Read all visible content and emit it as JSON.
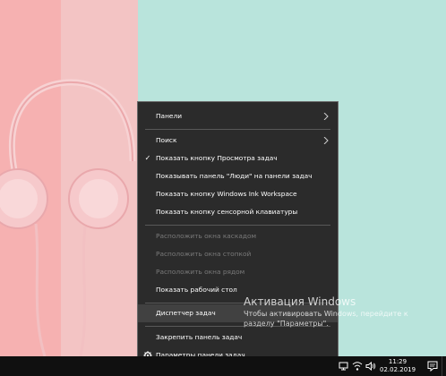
{
  "context_menu": {
    "items": [
      {
        "label": "Панели",
        "submenu": true
      },
      {
        "label": "Поиск",
        "submenu": true
      },
      {
        "label": "Показать кнопку Просмотра задач",
        "checked": true
      },
      {
        "label": "Показывать панель \"Люди\" на панели задач"
      },
      {
        "label": "Показать кнопку Windows Ink Workspace"
      },
      {
        "label": "Показать кнопку сенсорной клавиатуры"
      },
      {
        "label": "Расположить окна каскадом",
        "disabled": true
      },
      {
        "label": "Расположить окна стопкой",
        "disabled": true
      },
      {
        "label": "Расположить окна рядом",
        "disabled": true
      },
      {
        "label": "Показать рабочий стол"
      },
      {
        "label": "Диспетчер задач",
        "highlighted": true
      },
      {
        "label": "Закрепить панель задач"
      },
      {
        "label": "Параметры панели задач",
        "icon": "gear-icon"
      }
    ],
    "check_glyph": "✓"
  },
  "activation": {
    "title": "Активация Windows",
    "line1": "Чтобы активировать Windows, перейдите к",
    "line2": "разделу \"Параметры\"."
  },
  "taskbar": {
    "time": "11:29",
    "date": "02.02.2019",
    "tray_icons": [
      "network-icon",
      "wifi-icon",
      "volume-icon",
      "keyboard-layout-icon"
    ]
  },
  "colors": {
    "menu_bg": "#2b2b2b",
    "taskbar_bg": "#101010",
    "wallpaper_teal": "#b9e4dc",
    "wallpaper_pink": "#f6b1b1"
  }
}
